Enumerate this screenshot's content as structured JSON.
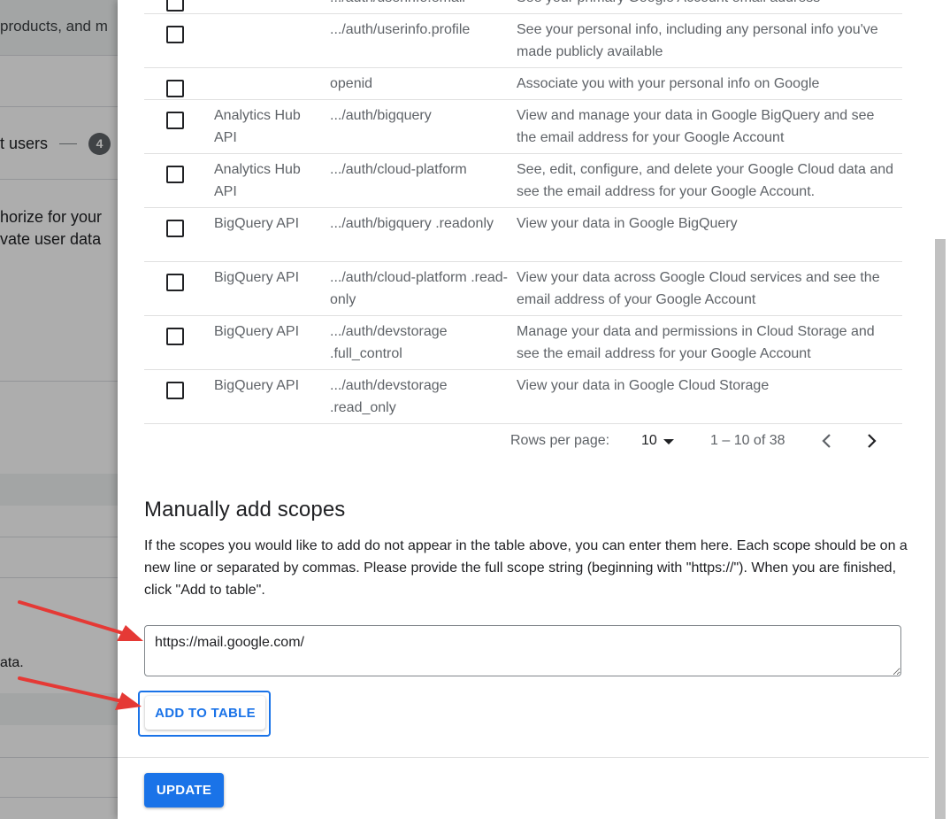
{
  "background": {
    "search_fragment": "products, and m",
    "step_label": "t users",
    "step_number": "4",
    "authorize_text_1": "horize for your",
    "authorize_text_2": "vate user data",
    "data_fragment": "ata."
  },
  "table": {
    "rows": [
      {
        "api": "",
        "scope": ".../auth/userinfo.email",
        "desc": "See your primary Google Account email address"
      },
      {
        "api": "",
        "scope": ".../auth/userinfo.profile",
        "desc": "See your personal info, including any personal info you've made publicly available"
      },
      {
        "api": "",
        "scope": "openid",
        "desc": "Associate you with your personal info on Google"
      },
      {
        "api": "Analytics Hub API",
        "scope": ".../auth/bigquery",
        "desc": "View and manage your data in Google BigQuery and see the email address for your Google Account"
      },
      {
        "api": "Analytics Hub API",
        "scope": ".../auth/cloud-platform",
        "desc": "See, edit, configure, and delete your Google Cloud data and see the email address for your Google Account."
      },
      {
        "api": "BigQuery API",
        "scope": ".../auth/bigquery .readonly",
        "desc": "View your data in Google BigQuery"
      },
      {
        "api": "BigQuery API",
        "scope": ".../auth/cloud-platform .read-only",
        "desc": "View your data across Google Cloud services and see the email address of your Google Account"
      },
      {
        "api": "BigQuery API",
        "scope": ".../auth/devstorage .full_control",
        "desc": "Manage your data and permissions in Cloud Storage and see the email address for your Google Account"
      },
      {
        "api": "BigQuery API",
        "scope": ".../auth/devstorage .read_only",
        "desc": "View your data in Google Cloud Storage"
      }
    ]
  },
  "pagination": {
    "rows_per_page_label": "Rows per page:",
    "rows_per_page_value": "10",
    "range": "1 – 10 of 38"
  },
  "manual": {
    "title": "Manually add scopes",
    "description": "If the scopes you would like to add do not appear in the table above, you can enter them here. Each scope should be on a new line or separated by commas. Please provide the full scope string (beginning with \"https://\"). When you are finished, click \"Add to table\".",
    "input_value": "https://mail.google.com/",
    "add_button": "ADD TO TABLE"
  },
  "footer": {
    "update_button": "UPDATE"
  },
  "colors": {
    "accent": "#1a73e8",
    "annotation_arrow": "#e53935"
  }
}
